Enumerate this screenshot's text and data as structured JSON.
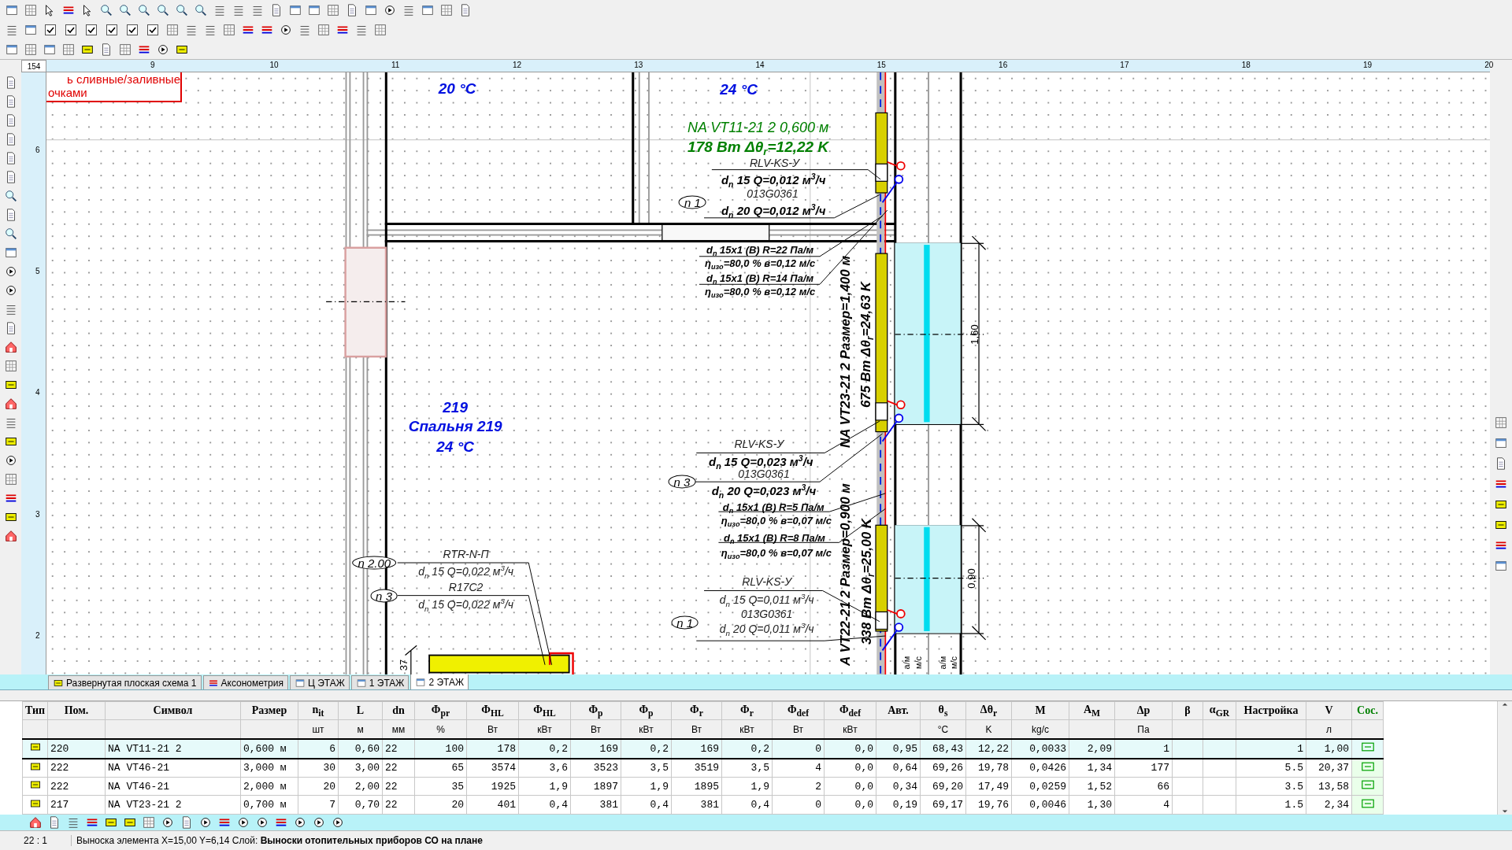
{
  "toolbar": {
    "checkboxes": [
      {
        "checked": true
      },
      {
        "checked": true
      },
      {
        "checked": true
      },
      {
        "checked": true
      },
      {
        "checked": true
      },
      {
        "checked": true
      }
    ]
  },
  "ruler": {
    "corner": "154",
    "x_marks": [
      "9",
      "10",
      "11",
      "12",
      "13",
      "14",
      "15",
      "16",
      "17",
      "18",
      "19",
      "20"
    ],
    "y_marks": [
      "6",
      "5",
      "4",
      "3",
      "2"
    ]
  },
  "drawing": {
    "note": [
      "ь сливные/заливные",
      "очками"
    ],
    "labels": [
      {
        "kind": "room",
        "text": "20 °C"
      },
      {
        "kind": "room",
        "text": "24 °C"
      },
      {
        "kind": "device",
        "text": "NA VT11-21 2  0,600 м"
      },
      {
        "kind": "device-bold",
        "text": "178 Вт Δθ$_{r}$=12,22 K"
      },
      {
        "kind": "callout",
        "text": "RLV-KS-У"
      },
      {
        "kind": "callout-bold",
        "text": "d$_{n}$ 15  Q=0,012 м$^{3}$/ч"
      },
      {
        "kind": "callout",
        "text": "013G0361"
      },
      {
        "kind": "bubble",
        "text": "n 1"
      },
      {
        "kind": "callout-bold",
        "text": "d$_{n}$ 20  Q=0,012 м$^{3}$/ч"
      },
      {
        "kind": "pipe",
        "text": "d$_{n}$ 15x1 (B)  R=22 Па/м"
      },
      {
        "kind": "pipe",
        "text": "η$_{изо}$=80,0 % в=0,12 м/с"
      },
      {
        "kind": "pipe",
        "text": "d$_{n}$ 15x1 (B)  R=14 Па/м"
      },
      {
        "kind": "pipe",
        "text": "η$_{изо}$=80,0 % в=0,12 м/с"
      },
      {
        "kind": "rotated",
        "text": "NA VT23-21 2  Размер=1,400 м"
      },
      {
        "kind": "rotated",
        "text": "675 Вт Δθ$_{r}$=24,63 K"
      },
      {
        "kind": "dimension",
        "text": "1,60"
      },
      {
        "kind": "room",
        "text": "219"
      },
      {
        "kind": "room",
        "text": "Спальня 219"
      },
      {
        "kind": "room",
        "text": "24 °C"
      },
      {
        "kind": "callout",
        "text": "RLV-KS-У"
      },
      {
        "kind": "callout-bold",
        "text": "d$_{n}$ 15  Q=0,023 м$^{3}$/ч"
      },
      {
        "kind": "callout",
        "text": "013G0361"
      },
      {
        "kind": "bubble",
        "text": "n 3"
      },
      {
        "kind": "callout-bold",
        "text": "d$_{n}$ 20  Q=0,023 м$^{3}$/ч"
      },
      {
        "kind": "pipe",
        "text": "d$_{n}$ 15x1 (B)  R=5 Па/м"
      },
      {
        "kind": "pipe",
        "text": "η$_{изо}$=80,0 % в=0,07 м/с"
      },
      {
        "kind": "pipe",
        "text": "d$_{n}$ 15x1 (B)  R=8 Па/м"
      },
      {
        "kind": "callout",
        "text": "RTR-N-П"
      },
      {
        "kind": "pipe",
        "text": "η$_{изо}$=80,0 % в=0,07 м/с"
      },
      {
        "kind": "rotated",
        "text": "A VT22-21 2  Размер=0,900 м"
      },
      {
        "kind": "rotated",
        "text": "338 Вт Δθ$_{r}$=25,00 K"
      },
      {
        "kind": "bubble",
        "text": "n 2.00"
      },
      {
        "kind": "callout",
        "text": "d$_{n}$ 15  Q=0,022 м$^{3}$/ч"
      },
      {
        "kind": "dimension",
        "text": "0,90"
      },
      {
        "kind": "callout",
        "text": "R17C2"
      },
      {
        "kind": "callout",
        "text": "RLV-KS-У"
      },
      {
        "kind": "bubble",
        "text": "n 3"
      },
      {
        "kind": "callout",
        "text": "d$_{n}$ 15  Q=0,022 м$^{3}$/ч"
      },
      {
        "kind": "callout",
        "text": "d$_{n}$ 15  Q=0,011 м$^{3}$/ч"
      },
      {
        "kind": "callout",
        "text": "013G0361"
      },
      {
        "kind": "bubble",
        "text": "n 1"
      },
      {
        "kind": "callout",
        "text": "d$_{n}$ 20  Q=0,011 м$^{3}$/ч"
      },
      {
        "kind": "dimension",
        "text": "37"
      },
      {
        "kind": "small",
        "text": "а/м"
      },
      {
        "kind": "small",
        "text": "м/с"
      },
      {
        "kind": "small",
        "text": "а/м"
      },
      {
        "kind": "small",
        "text": "м/с"
      }
    ]
  },
  "tabs": [
    {
      "label": "Развернутая плоская схема 1",
      "selected": false
    },
    {
      "label": "Аксонометрия",
      "selected": false
    },
    {
      "label": "Ц ЭТАЖ",
      "selected": false
    },
    {
      "label": "1 ЭТАЖ",
      "selected": false
    },
    {
      "label": "2 ЭТАЖ",
      "selected": true
    }
  ],
  "table": {
    "columns": [
      {
        "title": "Тип"
      },
      {
        "title": "Пом."
      },
      {
        "title": "Символ"
      },
      {
        "title": "Размер"
      },
      {
        "title": "n$_{it}$",
        "unit": "шт"
      },
      {
        "title": "L",
        "unit": "м"
      },
      {
        "title": "dn",
        "unit": "мм"
      },
      {
        "title": "Φ$_{pr}$",
        "unit": "%"
      },
      {
        "title": "Φ$_{HL}$",
        "unit": "Вт"
      },
      {
        "title": "Φ$_{HL}$",
        "unit": "кВт"
      },
      {
        "title": "Φ$_{p}$",
        "unit": "Вт"
      },
      {
        "title": "Φ$_{p}$",
        "unit": "кВт"
      },
      {
        "title": "Φ$_{r}$",
        "unit": "Вт"
      },
      {
        "title": "Φ$_{r}$",
        "unit": "кВт"
      },
      {
        "title": "Φ$_{def}$",
        "unit": "Вт"
      },
      {
        "title": "Φ$_{def}$",
        "unit": "кВт"
      },
      {
        "title": "Авт."
      },
      {
        "title": "θ$_{s}$",
        "unit": "°C"
      },
      {
        "title": "Δθ$_{r}$",
        "unit": "K"
      },
      {
        "title": "M",
        "unit": "kg/c"
      },
      {
        "title": "A$_{M}$"
      },
      {
        "title": "Δp",
        "unit": "Па"
      },
      {
        "title": "β"
      },
      {
        "title": "α$_{GR}$"
      },
      {
        "title": "Настройка"
      },
      {
        "title": "V",
        "unit": "л"
      },
      {
        "title": "Сос."
      }
    ],
    "rows": [
      {
        "selected": true,
        "cells": [
          "",
          "220",
          "NA VT11-21 2",
          "0,600 м",
          "6",
          "0,60",
          "22",
          "100",
          "178",
          "0,2",
          "169",
          "0,2",
          "169",
          "0,2",
          "0",
          "0,0",
          "0,95",
          "68,43",
          "12,22",
          "0,0033",
          "2,09",
          "1",
          "",
          "",
          "1",
          "1,00",
          ""
        ]
      },
      {
        "selected": false,
        "cells": [
          "",
          "222",
          "NA VT46-21",
          "3,000 м",
          "30",
          "3,00",
          "22",
          "65",
          "3574",
          "3,6",
          "3523",
          "3,5",
          "3519",
          "3,5",
          "4",
          "0,0",
          "0,64",
          "69,26",
          "19,78",
          "0,0426",
          "1,34",
          "177",
          "",
          "",
          "5.5",
          "20,37",
          ""
        ]
      },
      {
        "selected": false,
        "cells": [
          "",
          "222",
          "NA VT46-21",
          "2,000 м",
          "20",
          "2,00",
          "22",
          "35",
          "1925",
          "1,9",
          "1897",
          "1,9",
          "1895",
          "1,9",
          "2",
          "0,0",
          "0,34",
          "69,20",
          "17,49",
          "0,0259",
          "1,52",
          "66",
          "",
          "",
          "3.5",
          "13,58",
          ""
        ]
      },
      {
        "selected": false,
        "cells": [
          "",
          "217",
          "NA VT23-21 2",
          "0,700 м",
          "7",
          "0,70",
          "22",
          "20",
          "401",
          "0,4",
          "381",
          "0,4",
          "381",
          "0,4",
          "0",
          "0,0",
          "0,19",
          "69,17",
          "19,76",
          "0,0046",
          "1,30",
          "4",
          "",
          "",
          "1.5",
          "2,34",
          ""
        ]
      }
    ]
  },
  "status_bar": {
    "scale": "22 : 1",
    "message": "Выноска элемента  X=15,00  Y=6,14  Слой: **Выноски отопительных приборов СО на плане**"
  }
}
